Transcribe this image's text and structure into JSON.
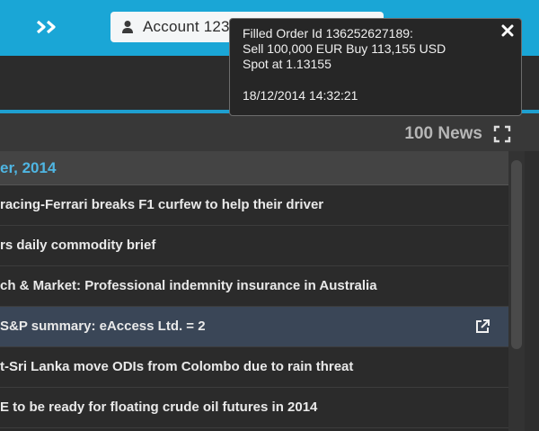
{
  "header": {
    "account_label": "Account 123"
  },
  "news_panel": {
    "count_label": "100 News",
    "date_header": "er, 2014",
    "items": [
      {
        "title": "racing-Ferrari breaks F1 curfew to help their driver",
        "selected": false
      },
      {
        "title": "rs daily commodity brief",
        "selected": false
      },
      {
        "title": "ch & Market: Professional indemnity insurance in Australia",
        "selected": false
      },
      {
        "title": "S&P summary: eAccess Ltd. = 2",
        "selected": true
      },
      {
        "title": "t-Sri Lanka move ODIs from Colombo due to rain threat",
        "selected": false
      },
      {
        "title": "E to be ready for floating crude oil futures in 2014",
        "selected": false
      }
    ]
  },
  "notification": {
    "line1": "Filled Order Id 136252627189:",
    "line2": "Sell 100,000 EUR Buy 113,155 USD",
    "line3": "Spot at 1.13155",
    "timestamp": "18/12/2014 14:32:21"
  },
  "icons": {
    "expand": "double-chevron-right-icon",
    "account": "person-icon",
    "fullscreen": "fullscreen-icon",
    "open": "external-link-icon",
    "close": "close-icon"
  },
  "colors": {
    "topbar": "#1aa6d6",
    "accent": "#1e9fd0",
    "date_text": "#4fb6e3",
    "selected_row": "#3a4657"
  }
}
